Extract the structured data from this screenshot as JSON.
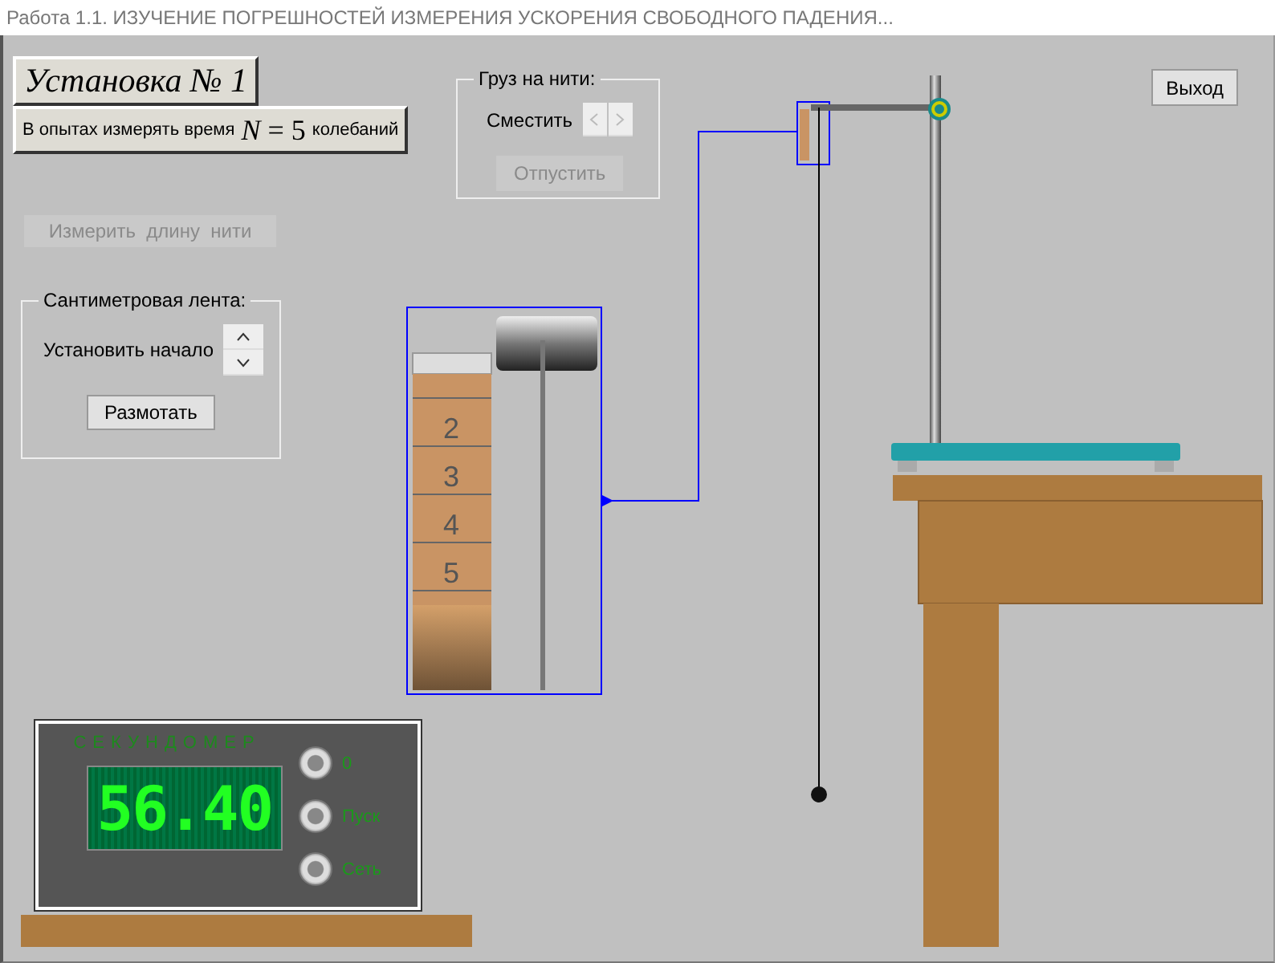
{
  "window": {
    "title": "Работа 1.1. ИЗУЧЕНИЕ ПОГРЕШНОСТЕЙ ИЗМЕРЕНИЯ УСКОРЕНИЯ СВОБОДНОГО ПАДЕНИЯ..."
  },
  "setup": {
    "title": "Установка № 1",
    "note_before": "В опытах измерять время",
    "formula": "*N* = 5",
    "note_after": "колебаний"
  },
  "measure_button": {
    "label": "Измерить  длину  нити",
    "disabled": true
  },
  "tape_panel": {
    "title": "Сантиметровая лента:",
    "set_start_label": "Установить начало",
    "unwind_button": "Размотать"
  },
  "weight_panel": {
    "title": "Груз на нити:",
    "shift_label": "Сместить",
    "shift_disabled": true,
    "release_button": {
      "label": "Отпустить",
      "disabled": true
    }
  },
  "exit_button": "Выход",
  "tape_marks": [
    "2",
    "3",
    "4",
    "5"
  ],
  "stopwatch": {
    "title": "СЕКУНДОМЕР",
    "reading": "56.40",
    "buttons": [
      "0",
      "Пуск",
      "Сеть"
    ]
  }
}
